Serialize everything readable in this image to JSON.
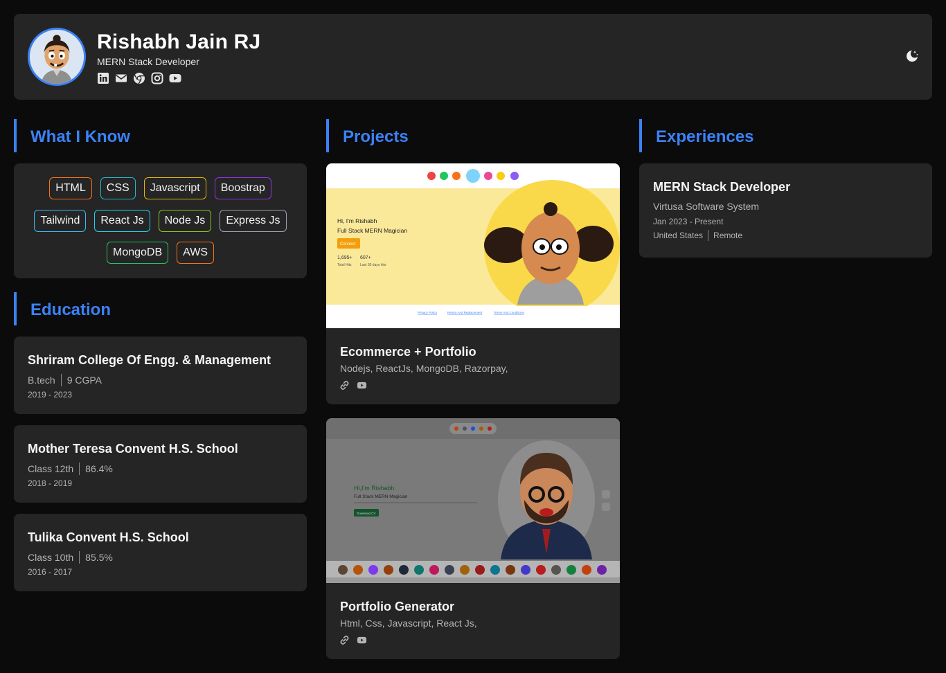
{
  "profile": {
    "name": "Rishabh Jain RJ",
    "role": "MERN Stack Developer",
    "avatar_icon": "cartoon-avatar",
    "socials": [
      "linkedin-icon",
      "mail-icon",
      "chrome-icon",
      "instagram-icon",
      "youtube-icon"
    ]
  },
  "theme_icon": "moon-stars-icon",
  "colors": {
    "accent": "#3b82f6",
    "background": "#0b0b0c",
    "card": "#252526"
  },
  "skills": {
    "title": "What I Know",
    "items": [
      {
        "label": "HTML",
        "color": "#f97316"
      },
      {
        "label": "CSS",
        "color": "#22b8cf"
      },
      {
        "label": "Javascript",
        "color": "#eab308"
      },
      {
        "label": "Boostrap",
        "color": "#9333ea"
      },
      {
        "label": "Tailwind",
        "color": "#38bdf8"
      },
      {
        "label": "React Js",
        "color": "#22d3ee"
      },
      {
        "label": "Node Js",
        "color": "#84cc16"
      },
      {
        "label": "Express Js",
        "color": "#9ca3af"
      },
      {
        "label": "MongoDB",
        "color": "#22c55e"
      },
      {
        "label": "AWS",
        "color": "#f97316"
      }
    ]
  },
  "education": {
    "title": "Education",
    "items": [
      {
        "school": "Shriram College Of Engg. & Management",
        "degree": "B.tech",
        "score": "9 CGPA",
        "years": "2019 - 2023"
      },
      {
        "school": "Mother Teresa Convent H.S. School",
        "degree": "Class 12th",
        "score": "86.4%",
        "years": "2018 - 2019"
      },
      {
        "school": "Tulika Convent H.S. School",
        "degree": "Class 10th",
        "score": "85.5%",
        "years": "2016 - 2017"
      }
    ]
  },
  "projects": {
    "title": "Projects",
    "items": [
      {
        "title": "Ecommerce + Portfolio",
        "stack": "Nodejs, ReactJs, MongoDB, Razorpay,",
        "links": [
          "link-icon",
          "youtube-icon"
        ],
        "preview": {
          "greeting": "Hi, I'm Rishabh",
          "tagline": "Full Stack MERN Magician",
          "button": "Connect",
          "stat1_value": "1,695+",
          "stat1_label": "Total Hits",
          "stat2_value": "607+",
          "stat2_label": "Last 30 days hits",
          "footer_links": [
            "Privacy Policy",
            "Return And Replacement",
            "Terms And Conditions"
          ]
        }
      },
      {
        "title": "Portfolio Generator",
        "stack": "Html, Css, Javascript, React Js,",
        "links": [
          "link-icon",
          "youtube-icon"
        ],
        "preview": {
          "greeting": "Hi,I'm Rishabh",
          "tagline": "Full Stack MERN Magician",
          "button": "Download CV"
        }
      }
    ]
  },
  "experiences": {
    "title": "Experiences",
    "items": [
      {
        "title": "MERN Stack Developer",
        "company": "Virtusa Software System",
        "dates": "Jan 2023 - Present",
        "location": "United States",
        "mode": "Remote"
      }
    ]
  }
}
